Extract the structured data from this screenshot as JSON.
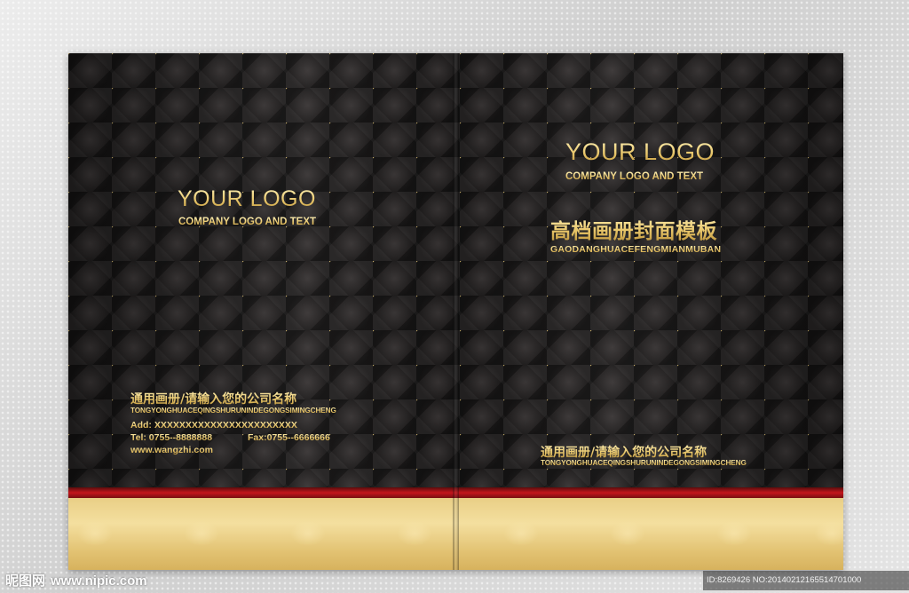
{
  "left_cover": {
    "logo": "YOUR LOGO",
    "logo_sub": "COMPANY LOGO AND TEXT",
    "company_cn": "通用画册/请输入您的公司名称",
    "company_pinyin": "TONGYONGHUACEQINGSHURUNINDEGONGSIMINGCHENG",
    "address": "Add: XXXXXXXXXXXXXXXXXXXXXXX",
    "tel": "Tel: 0755--8888888",
    "fax": "Fax:0755--6666666",
    "website": "www.wangzhi.com"
  },
  "right_cover": {
    "logo": "YOUR LOGO",
    "logo_sub": "COMPANY LOGO AND TEXT",
    "title_cn": "高档画册封面模板",
    "title_pinyin": "GAODANGHUACEFENGMIANMUBAN",
    "company_cn": "通用画册/请输入您的公司名称",
    "company_pinyin": "TONGYONGHUACEQINGSHURUNINDEGONGSIMINGCHENG"
  },
  "watermark": {
    "site_name": "昵图网",
    "site_url": "www.nipic.com",
    "image_id": "ID:8269426 NO:20140212165514701000"
  },
  "colors": {
    "background": "#d9d9d9",
    "dark_panel": "#1a1818",
    "gold": "#e7cf7d",
    "red_band": "#c4161c",
    "gold_band": "#f4df9f"
  }
}
